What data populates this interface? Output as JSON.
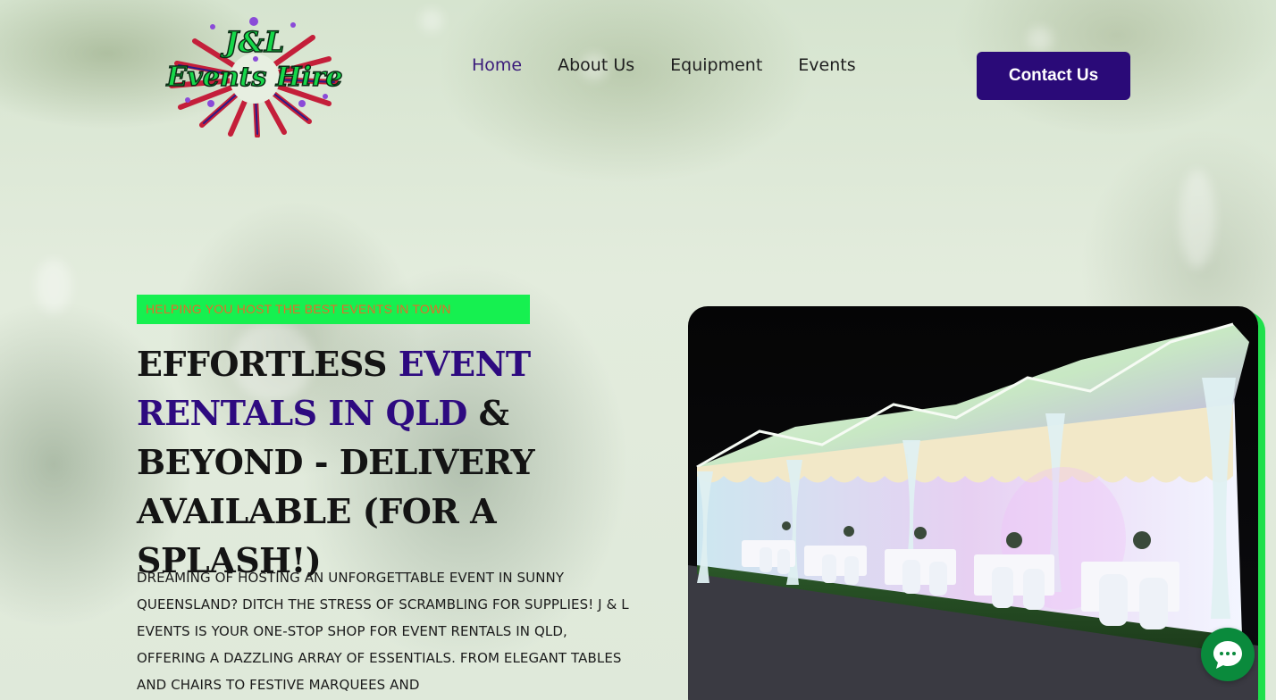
{
  "brand": {
    "logo_line1": "J&L",
    "logo_line2": "Events Hire"
  },
  "nav": {
    "items": [
      {
        "label": "Home",
        "active": true
      },
      {
        "label": "About Us",
        "active": false
      },
      {
        "label": "Equipment",
        "active": false
      },
      {
        "label": "Events",
        "active": false
      }
    ],
    "cta_label": "Contact Us"
  },
  "hero": {
    "tagline": "HELPING YOU HOST THE BEST EVENTS IN TOWN",
    "headline_part1": "EFFORTLESS ",
    "headline_highlight": "EVENT RENTALS IN QLD",
    "headline_part2": " & BEYOND - DELIVERY AVAILABLE (FOR A SPLASH!)",
    "description": "DREAMING OF HOSTING AN UNFORGETTABLE EVENT IN SUNNY QUEENSLAND? DITCH THE STRESS OF SCRAMBLING FOR SUPPLIES! J & L EVENTS IS YOUR ONE-STOP SHOP FOR EVENT RENTALS IN QLD, OFFERING A DAZZLING ARRAY OF ESSENTIALS. FROM ELEGANT TABLES AND CHAIRS TO FESTIVE MARQUEES AND"
  },
  "colors": {
    "accent_purple": "#2a0a78",
    "accent_green": "#16f050",
    "tagline_text": "#e46c2c",
    "chat_green": "#0a8a3c"
  },
  "icons": {
    "chat": "chat-bubble-icon",
    "logo": "fireworks-logo"
  }
}
